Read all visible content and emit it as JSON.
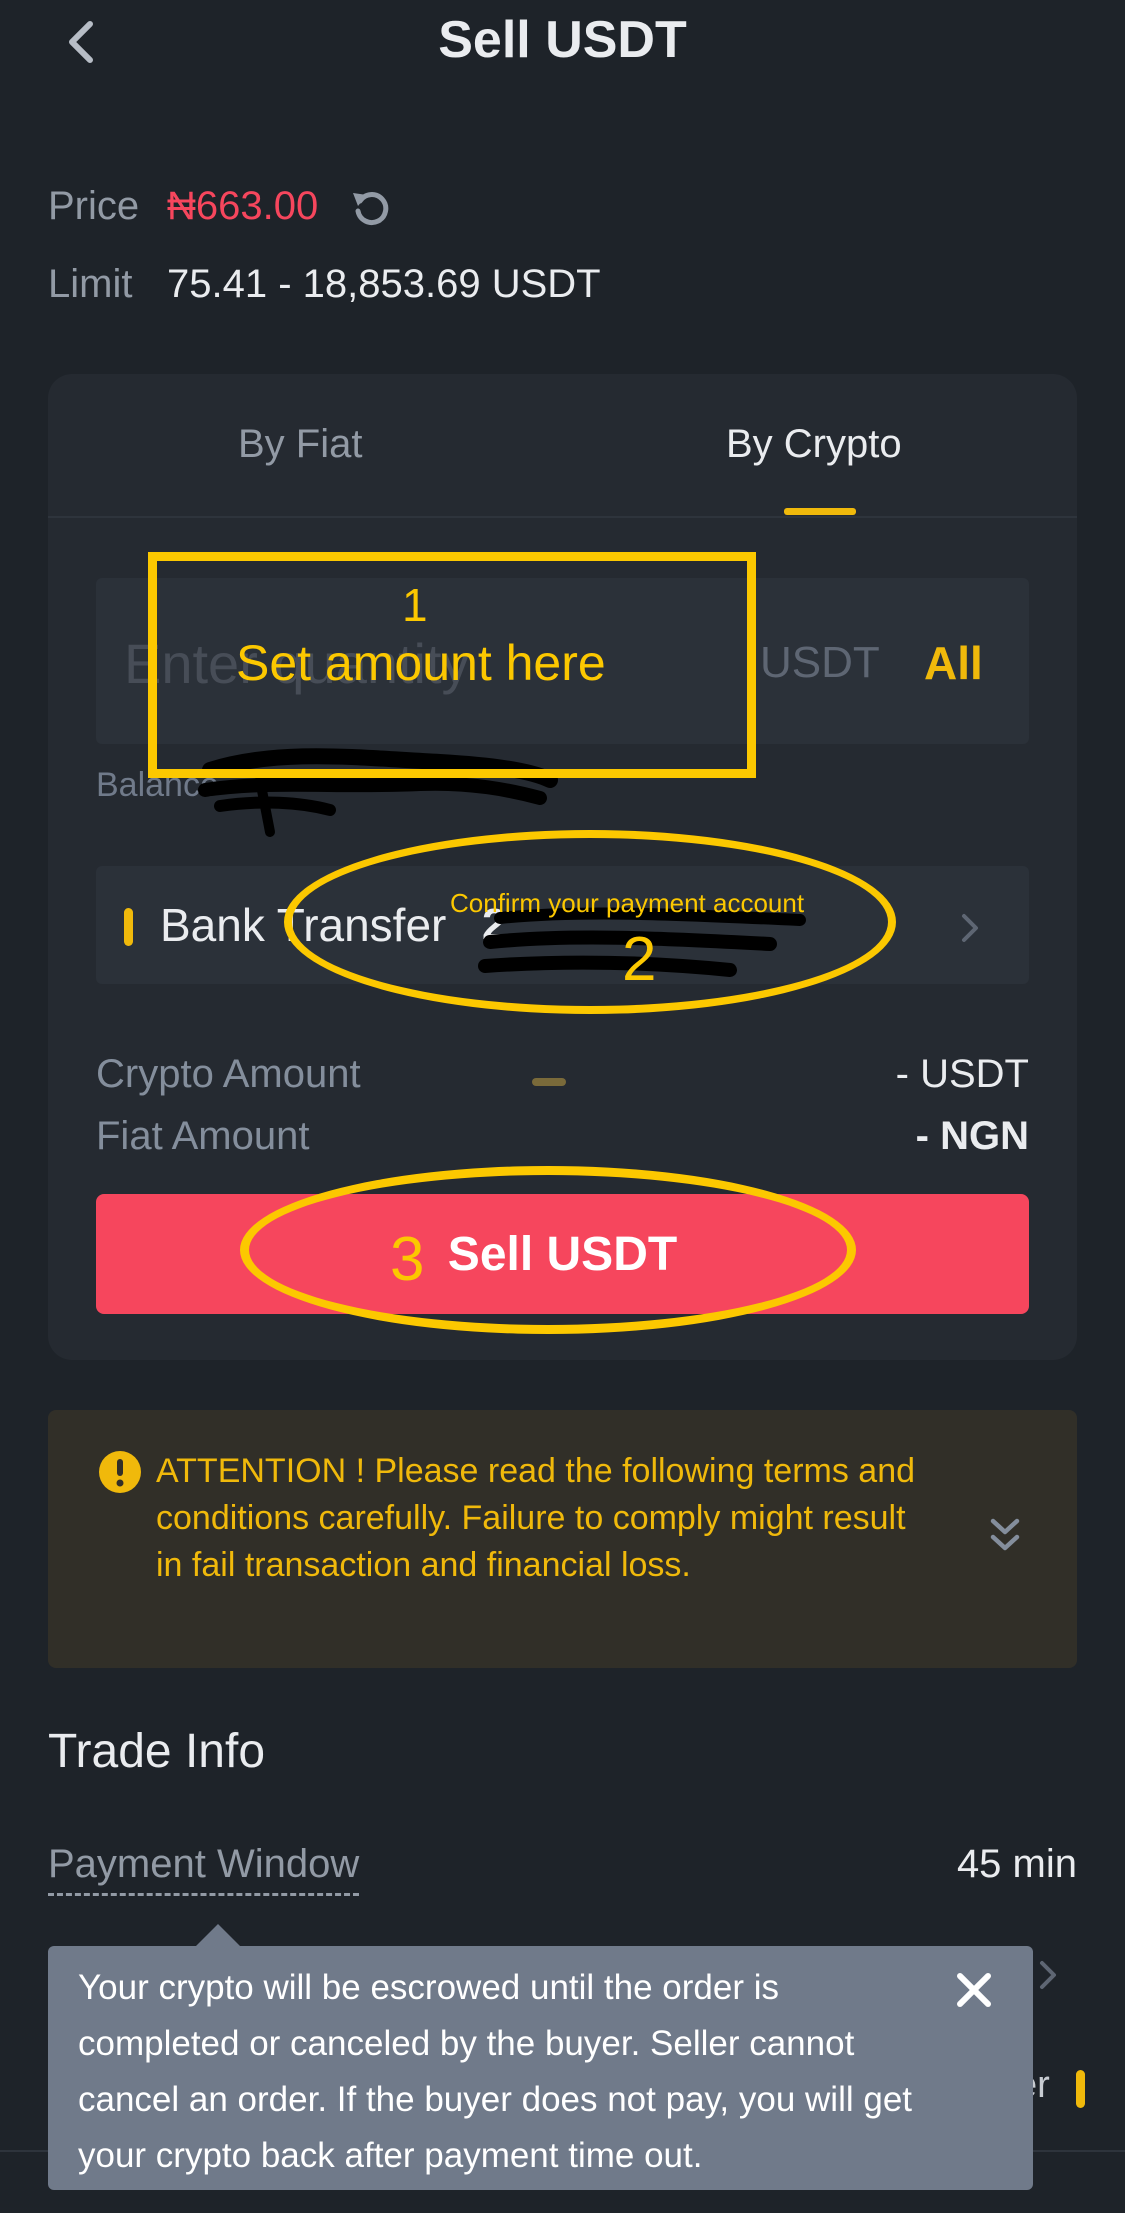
{
  "header": {
    "title": "Sell USDT"
  },
  "ad": {
    "price_label": "Price",
    "price_value": "₦663.00",
    "limit_label": "Limit",
    "limit_value": "75.41 - 18,853.69 USDT"
  },
  "tabs": [
    {
      "label": "By Fiat",
      "active": false
    },
    {
      "label": "By Crypto",
      "active": true
    }
  ],
  "quantity": {
    "placeholder": "Enter quantity",
    "unit": "USDT",
    "all_label": "All",
    "balance_label": "Balance"
  },
  "payment": {
    "method": "Bank Transfer",
    "account_visible": "2"
  },
  "amounts": {
    "crypto_label": "Crypto Amount",
    "crypto_value": "- USDT",
    "fiat_label": "Fiat Amount",
    "fiat_value": "- NGN"
  },
  "sell_button": "Sell USDT",
  "attention": {
    "text": "ATTENTION ! Please read the following terms and conditions carefully. Failure to comply might result in fail transaction and financial loss."
  },
  "trade_info": {
    "title": "Trade Info",
    "payment_window_label": "Payment Window",
    "payment_window_value": "45 min",
    "partial_text": "er"
  },
  "tooltip": {
    "text": "Your crypto will be escrowed until the order is completed or canceled by the buyer. Seller cannot cancel an order. If the buyer does not pay, you will get your crypto back after payment time out."
  },
  "annotations": {
    "step1_number": "1",
    "step1_text": "Set amount here",
    "step2_text": "Confirm your payment account",
    "step2_number": "2",
    "step3_number": "3"
  },
  "colors": {
    "background": "#1e2329",
    "card": "#252a31",
    "accent": "#f0b90b",
    "sell_red": "#f6465d",
    "annotation": "#fcc800"
  }
}
